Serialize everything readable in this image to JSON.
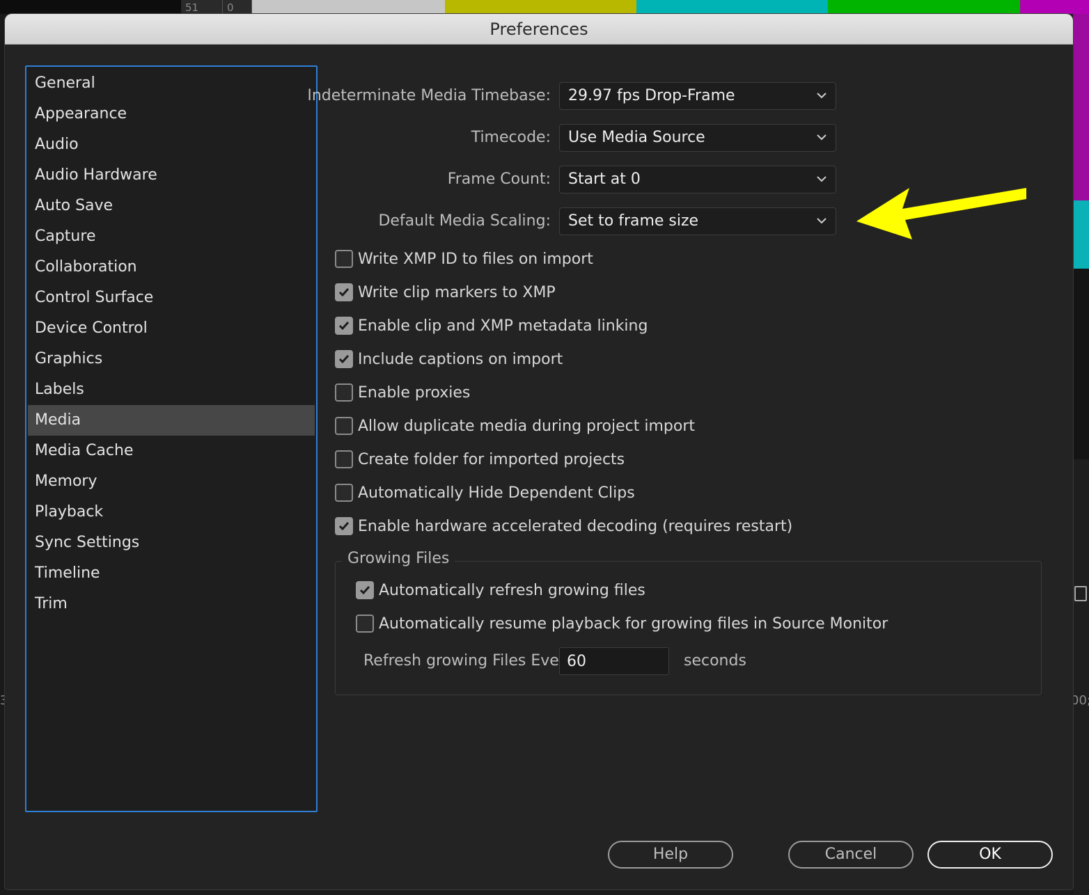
{
  "window": {
    "title": "Preferences"
  },
  "background": {
    "ruler_a": "51",
    "ruler_b": "0",
    "left_fragment": "3",
    "right_fragment": "00;",
    "bar_colors": [
      "#c6c6c6",
      "#b8b800",
      "#00b3b5",
      "#00b400",
      "#b400b4"
    ]
  },
  "sidebar": {
    "items": [
      {
        "label": "General"
      },
      {
        "label": "Appearance"
      },
      {
        "label": "Audio"
      },
      {
        "label": "Audio Hardware"
      },
      {
        "label": "Auto Save"
      },
      {
        "label": "Capture"
      },
      {
        "label": "Collaboration"
      },
      {
        "label": "Control Surface"
      },
      {
        "label": "Device Control"
      },
      {
        "label": "Graphics"
      },
      {
        "label": "Labels"
      },
      {
        "label": "Media",
        "selected": true
      },
      {
        "label": "Media Cache"
      },
      {
        "label": "Memory"
      },
      {
        "label": "Playback"
      },
      {
        "label": "Sync Settings"
      },
      {
        "label": "Timeline"
      },
      {
        "label": "Trim"
      }
    ]
  },
  "media": {
    "timebase": {
      "label": "Indeterminate Media Timebase:",
      "value": "29.97 fps Drop-Frame"
    },
    "timecode": {
      "label": "Timecode:",
      "value": "Use Media Source"
    },
    "frame_count": {
      "label": "Frame Count:",
      "value": "Start at 0"
    },
    "scaling": {
      "label": "Default Media Scaling:",
      "value": "Set to frame size"
    },
    "checkboxes": [
      {
        "label": "Write XMP ID to files on import",
        "checked": false
      },
      {
        "label": "Write clip markers to XMP",
        "checked": true
      },
      {
        "label": "Enable clip and XMP metadata linking",
        "checked": true
      },
      {
        "label": "Include captions on import",
        "checked": true
      },
      {
        "label": "Enable proxies",
        "checked": false
      },
      {
        "label": "Allow duplicate media during project import",
        "checked": false
      },
      {
        "label": "Create folder for imported projects",
        "checked": false
      },
      {
        "label": "Automatically Hide Dependent Clips",
        "checked": false
      },
      {
        "label": "Enable hardware accelerated decoding (requires restart)",
        "checked": true
      }
    ],
    "growing": {
      "title": "Growing Files",
      "refresh": {
        "label": "Automatically refresh growing files",
        "checked": true
      },
      "resume": {
        "label": "Automatically resume playback for growing files in Source Monitor",
        "checked": false
      },
      "interval_label": "Refresh growing Files Every",
      "interval_value": "60",
      "interval_unit": "seconds"
    }
  },
  "buttons": {
    "help": "Help",
    "cancel": "Cancel",
    "ok": "OK"
  },
  "annotation": {
    "arrow_color": "#ffff00"
  }
}
